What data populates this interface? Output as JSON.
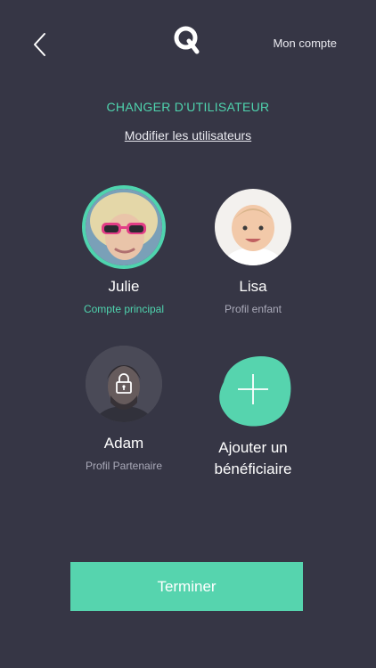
{
  "header": {
    "back_icon": "chevron-left-icon",
    "logo_icon": "q-logo-icon",
    "account_label": "Mon compte"
  },
  "section": {
    "title": "CHANGER D'UTILISATEUR",
    "edit_link": "Modifier les utilisateurs"
  },
  "profiles": [
    {
      "name": "Julie",
      "role": "Compte principal",
      "active": true,
      "locked": false
    },
    {
      "name": "Lisa",
      "role": "Profil enfant",
      "active": false,
      "locked": false
    },
    {
      "name": "Adam",
      "role": "Profil Partenaire",
      "active": false,
      "locked": true
    }
  ],
  "add": {
    "label_line1": "Ajouter un",
    "label_line2": "bénéficiaire",
    "icon": "plus-icon"
  },
  "footer": {
    "finish_label": "Terminer"
  },
  "colors": {
    "background": "#363645",
    "accent": "#56d4ae"
  }
}
